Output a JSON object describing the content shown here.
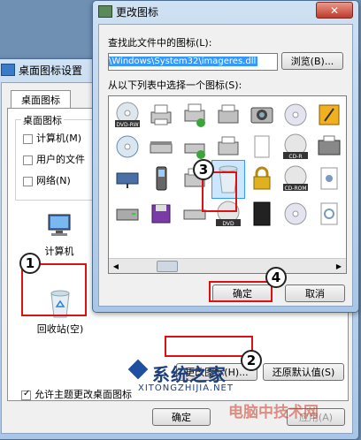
{
  "desktop_dialog": {
    "title": "桌面图标设置",
    "tab": "桌面图标",
    "group_label": "桌面图标",
    "checkboxes": [
      {
        "label": "计算机(M)",
        "checked": false
      },
      {
        "label": "用户的文件",
        "checked": false
      },
      {
        "label": "网络(N)",
        "checked": false
      }
    ],
    "icons": [
      {
        "label": "计算机",
        "icon": "computer-icon"
      },
      {
        "label": "回收站(空)",
        "icon": "recycle-bin-icon"
      }
    ],
    "change_icon_button": "更改图标(H)...",
    "restore_default_button": "还原默认值(S)",
    "allow_themes_label": "允许主题更改桌面图标",
    "allow_themes_checked": true,
    "ok_button": "确定",
    "apply_button": "应用(A)"
  },
  "change_dialog": {
    "title": "更改图标",
    "find_label": "查找此文件中的图标(L):",
    "path_value": "\\Windows\\System32\\imageres.dll",
    "browse_button": "浏览(B)...",
    "list_label": "从以下列表中选择一个图标(S):",
    "ok_button": "确定",
    "cancel_button": "取消",
    "icon_labels": {
      "dvdrw": "DVD-RW",
      "cdr": "CD-R",
      "cdrom": "CD-ROM",
      "dvd": "DVD"
    }
  },
  "annotations": [
    "1",
    "2",
    "3",
    "4"
  ],
  "watermark": {
    "title": "系统之家",
    "url": "XITONGZHIJIA.NET",
    "site": "电脑中技术网"
  },
  "colors": {
    "accent": "#3399ff",
    "annotation_red": "#dd1111"
  }
}
